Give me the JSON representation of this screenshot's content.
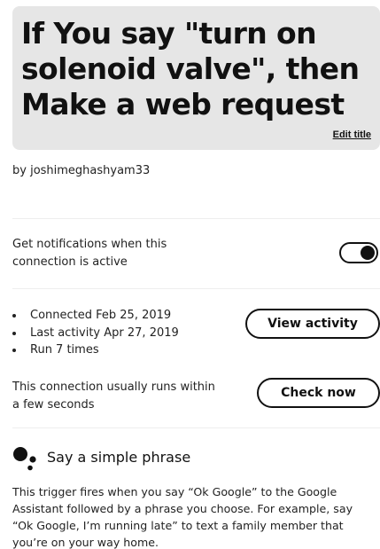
{
  "applet": {
    "title": "If You say \"turn on solenoid valve\", then Make a web request",
    "edit_title_label": "Edit title",
    "author": "by joshimeghashyam33"
  },
  "notifications": {
    "label": "Get notifications when this connection is active",
    "enabled": true
  },
  "activity": {
    "stats": [
      "Connected Feb 25, 2019",
      "Last activity Apr 27, 2019",
      "Run 7 times"
    ],
    "view_activity_label": "View activity",
    "runs_within_text": "This connection usually runs within a few seconds",
    "check_now_label": "Check now"
  },
  "trigger": {
    "icon": "google-assistant-icon",
    "name": "Say a simple phrase",
    "description": "This trigger fires when you say “Ok Google” to the Google Assistant followed by a phrase you choose. For example, say “Ok Google, I’m running late” to text a family member that you’re on your way home."
  },
  "colors": {
    "title_background": "#e6e6e6",
    "text": "#222222",
    "accent": "#111111"
  }
}
